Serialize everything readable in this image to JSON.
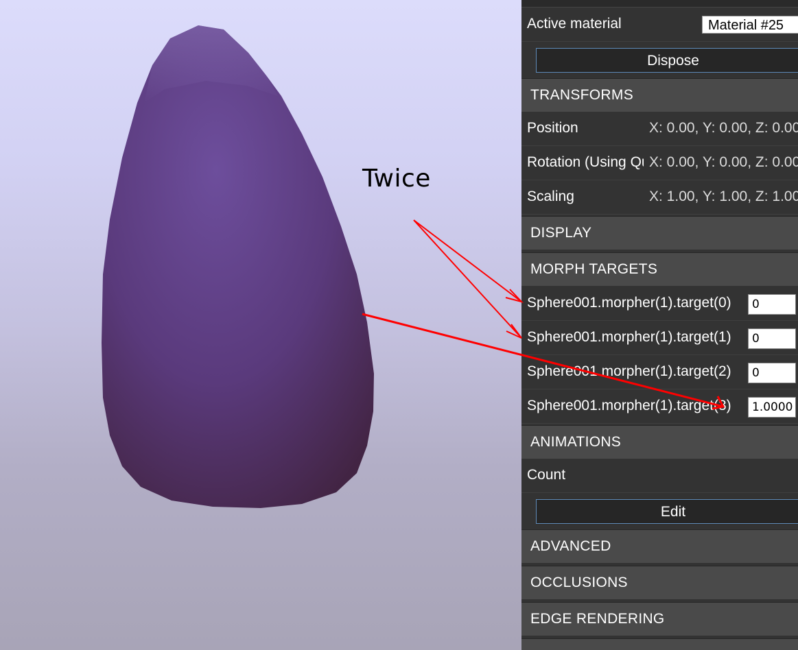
{
  "annotation": {
    "text": "Twice",
    "color": "#ff0000"
  },
  "mesh": {
    "color_top": "#7a5aa8",
    "color_bottom": "#4a2848"
  },
  "inspector": {
    "active_material": {
      "label": "Active material",
      "value": "Material #25"
    },
    "dispose_label": "Dispose",
    "sections": {
      "transforms": "TRANSFORMS",
      "display": "DISPLAY",
      "morph_targets": "MORPH TARGETS",
      "animations": "ANIMATIONS",
      "advanced": "ADVANCED",
      "occlusions": "OCCLUSIONS",
      "edge_rendering": "EDGE RENDERING"
    },
    "transforms": {
      "position": {
        "label": "Position",
        "value": "X: 0.00, Y: 0.00, Z: 0.00"
      },
      "rotation": {
        "label": "Rotation (Using Quaternion)",
        "value": "X: 0.00, Y: 0.00, Z: 0.00"
      },
      "scaling": {
        "label": "Scaling",
        "value": "X: 1.00, Y: 1.00, Z: 1.00"
      }
    },
    "morph_targets": [
      {
        "label": "Sphere001.morpher(1).target(0)",
        "value": "0"
      },
      {
        "label": "Sphere001.morpher(1).target(1)",
        "value": "0"
      },
      {
        "label": "Sphere001.morpher(1).target(2)",
        "value": "0"
      },
      {
        "label": "Sphere001.morpher(1).target(3)",
        "value": "1.0000"
      }
    ],
    "animations": {
      "count_label": "Count",
      "edit_label": "Edit"
    }
  }
}
